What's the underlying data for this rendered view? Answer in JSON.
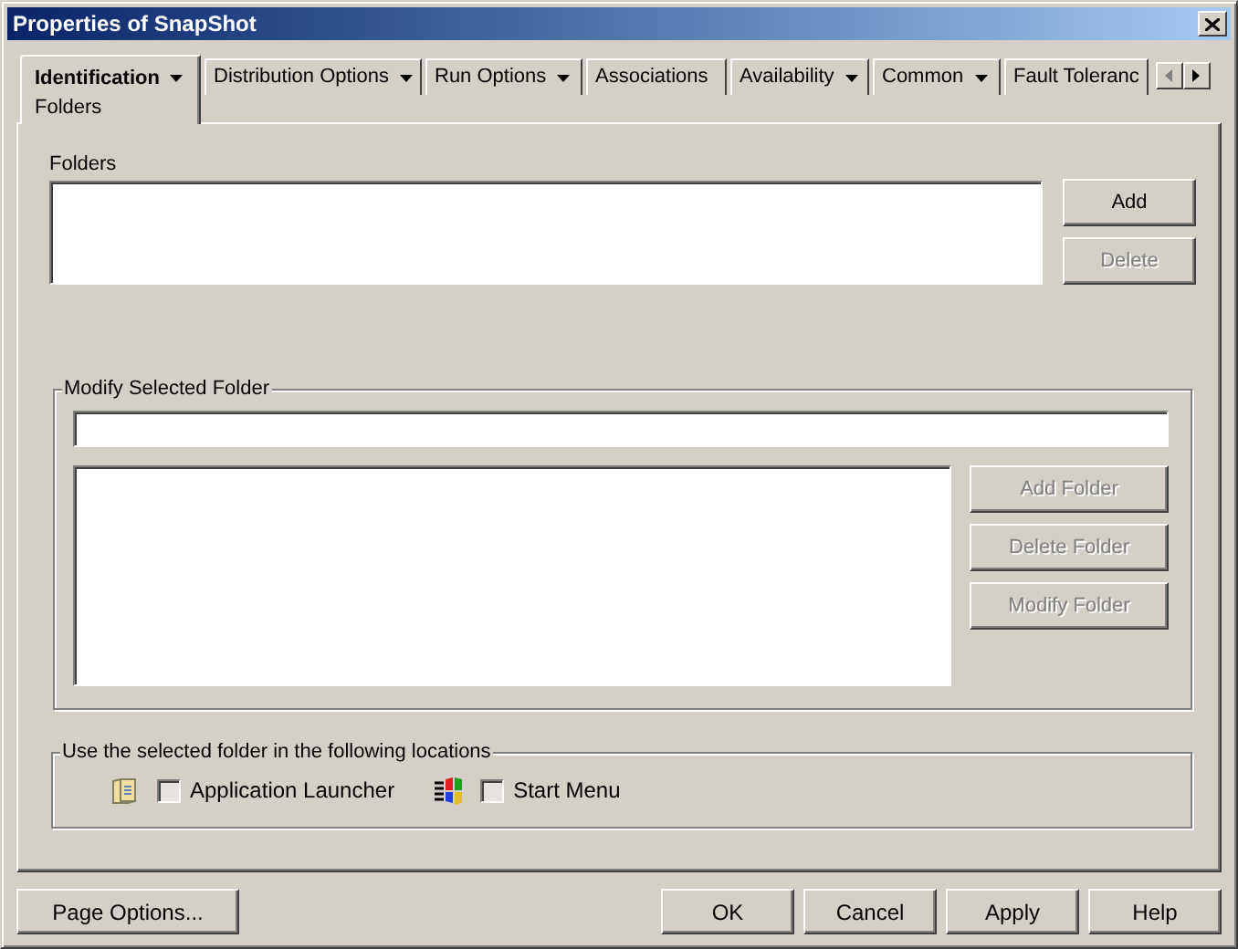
{
  "window": {
    "title": "Properties of SnapShot"
  },
  "tabs": [
    {
      "label": "Identification",
      "subtitle": "Folders",
      "selected": true,
      "dropdown": true
    },
    {
      "label": "Distribution Options",
      "selected": false,
      "dropdown": true
    },
    {
      "label": "Run Options",
      "selected": false,
      "dropdown": true
    },
    {
      "label": "Associations",
      "selected": false,
      "dropdown": false
    },
    {
      "label": "Availability",
      "selected": false,
      "dropdown": true
    },
    {
      "label": "Common",
      "selected": false,
      "dropdown": true
    },
    {
      "label": "Fault Toleranc",
      "selected": false,
      "dropdown": false
    }
  ],
  "folders": {
    "label": "Folders",
    "buttons": [
      {
        "label": "Add",
        "disabled": false
      },
      {
        "label": "Delete",
        "disabled": true
      }
    ]
  },
  "modify_group": {
    "title": "Modify Selected Folder",
    "buttons": [
      {
        "label": "Add Folder",
        "disabled": true
      },
      {
        "label": "Delete Folder",
        "disabled": true
      },
      {
        "label": "Modify Folder",
        "disabled": true
      }
    ]
  },
  "locations_group": {
    "title": "Use the selected folder in the following locations",
    "options": [
      {
        "kind": "launcher",
        "label": "Application Launcher",
        "checked": false
      },
      {
        "kind": "start-menu",
        "label": "Start Menu",
        "checked": false
      }
    ]
  },
  "footer_buttons": [
    {
      "label": "Page Options..."
    },
    {
      "label": "OK"
    },
    {
      "label": "Cancel"
    },
    {
      "label": "Apply"
    },
    {
      "label": "Help"
    }
  ]
}
